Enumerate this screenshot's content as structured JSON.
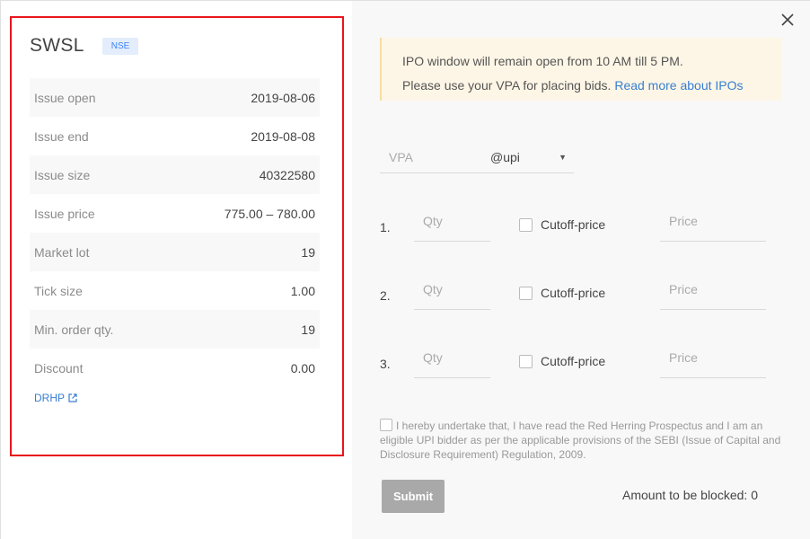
{
  "header": {
    "symbol": "SWSL",
    "exchange": "NSE"
  },
  "details": [
    {
      "label": "Issue open",
      "value": "2019-08-06"
    },
    {
      "label": "Issue end",
      "value": "2019-08-08"
    },
    {
      "label": "Issue size",
      "value": "40322580"
    },
    {
      "label": "Issue price",
      "value": "775.00 – 780.00"
    },
    {
      "label": "Market lot",
      "value": "19"
    },
    {
      "label": "Tick size",
      "value": "1.00"
    },
    {
      "label": "Min. order qty.",
      "value": "19"
    },
    {
      "label": "Discount",
      "value": "0.00"
    }
  ],
  "drhp_link": "DRHP",
  "notice": {
    "line1": "IPO window will remain open from 10 AM till 5 PM.",
    "line2": "Please use your VPA for placing bids.",
    "link": "Read more about IPOs"
  },
  "vpa": {
    "placeholder": "VPA",
    "selected": "@upi"
  },
  "bids": [
    {
      "num": "1.",
      "qty_placeholder": "Qty",
      "cutoff_label": "Cutoff-price",
      "price_placeholder": "Price"
    },
    {
      "num": "2.",
      "qty_placeholder": "Qty",
      "cutoff_label": "Cutoff-price",
      "price_placeholder": "Price"
    },
    {
      "num": "3.",
      "qty_placeholder": "Qty",
      "cutoff_label": "Cutoff-price",
      "price_placeholder": "Price"
    }
  ],
  "undertaking": "I hereby undertake that, I have read the Red Herring Prospectus and I am an eligible UPI bidder as per the applicable provisions of the SEBI (Issue of Capital and Disclosure Requirement) Regulation, 2009.",
  "submit_label": "Submit",
  "amount_text": "Amount to be blocked: 0",
  "colors": {
    "highlight": "#e8141c",
    "accent": "#387ed1",
    "notice_bg": "#fdf6e6"
  }
}
